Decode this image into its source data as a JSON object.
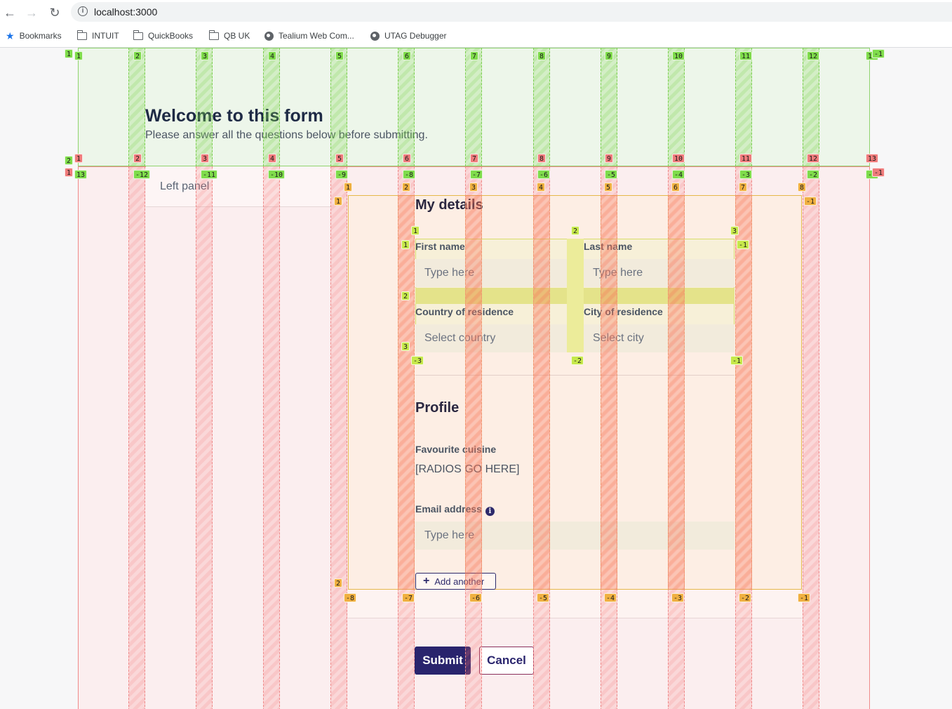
{
  "browser": {
    "url": "localhost:3000",
    "bookmarks": [
      {
        "label": "Bookmarks",
        "icon": "star-icon"
      },
      {
        "label": "INTUIT",
        "icon": "folder-icon"
      },
      {
        "label": "QuickBooks",
        "icon": "folder-icon"
      },
      {
        "label": "QB UK",
        "icon": "folder-icon"
      },
      {
        "label": "Tealium Web Com...",
        "icon": "globe-icon"
      },
      {
        "label": "UTAG Debugger",
        "icon": "globe-icon"
      }
    ]
  },
  "header": {
    "title": "Welcome to this form",
    "subtitle": "Please answer all the questions below before submitting."
  },
  "left_panel": {
    "label": "Left panel"
  },
  "sections": {
    "my_details": {
      "title": "My details",
      "first_name": {
        "label": "First name",
        "placeholder": "Type here"
      },
      "last_name": {
        "label": "Last name",
        "placeholder": "Type here"
      },
      "country": {
        "label": "Country of residence",
        "placeholder": "Select country"
      },
      "city": {
        "label": "City of residence",
        "placeholder": "Select city"
      }
    },
    "profile": {
      "title": "Profile",
      "cuisine": {
        "label": "Favourite cuisine",
        "value": "[RADIOS GO HERE]"
      },
      "email": {
        "label": "Email address",
        "placeholder": "Type here",
        "info_icon": "info-icon",
        "info_glyph": "i"
      },
      "add_another": "Add another"
    }
  },
  "actions": {
    "submit": "Submit",
    "cancel": "Cancel"
  },
  "grid_overlay": {
    "colors": {
      "outer": "#7fdc4b",
      "body": "#ef7b7b",
      "card": "#f0b040",
      "fields": "#c6e84a"
    },
    "outer_top": [
      "1",
      "2",
      "3",
      "4",
      "5",
      "6",
      "7",
      "8",
      "9",
      "10",
      "11",
      "12",
      "13"
    ],
    "outer_top_end": "-1",
    "outer_top_corner": "1",
    "outer_bottom_red": [
      "1",
      "2",
      "3",
      "4",
      "5",
      "6",
      "7",
      "8",
      "9",
      "10",
      "11",
      "12",
      "13"
    ],
    "outer_bottom_corner": "2",
    "body_top_green": [
      "13",
      "-12",
      "-11",
      "-10",
      "-9",
      "-8",
      "-7",
      "-6",
      "-5",
      "-4",
      "-3",
      "-2",
      "-1"
    ],
    "body_top_red_end": "-1",
    "body_top_corner": "1",
    "card_top": [
      "1",
      "2",
      "3",
      "4",
      "5",
      "6",
      "7",
      "8"
    ],
    "card_row_start": "1",
    "card_row_end": "-1",
    "card_row_bottom": "2",
    "card_bottom": [
      "-8",
      "-7",
      "-6",
      "-5",
      "-4",
      "-3",
      "-2",
      "-1"
    ],
    "fields_cols_top": [
      "1",
      "2",
      "3"
    ],
    "fields_rows": [
      "1",
      "2",
      "3"
    ],
    "fields_row_end": "-1",
    "fields_cols_bottom": [
      "-3",
      "-2",
      "-1"
    ]
  }
}
